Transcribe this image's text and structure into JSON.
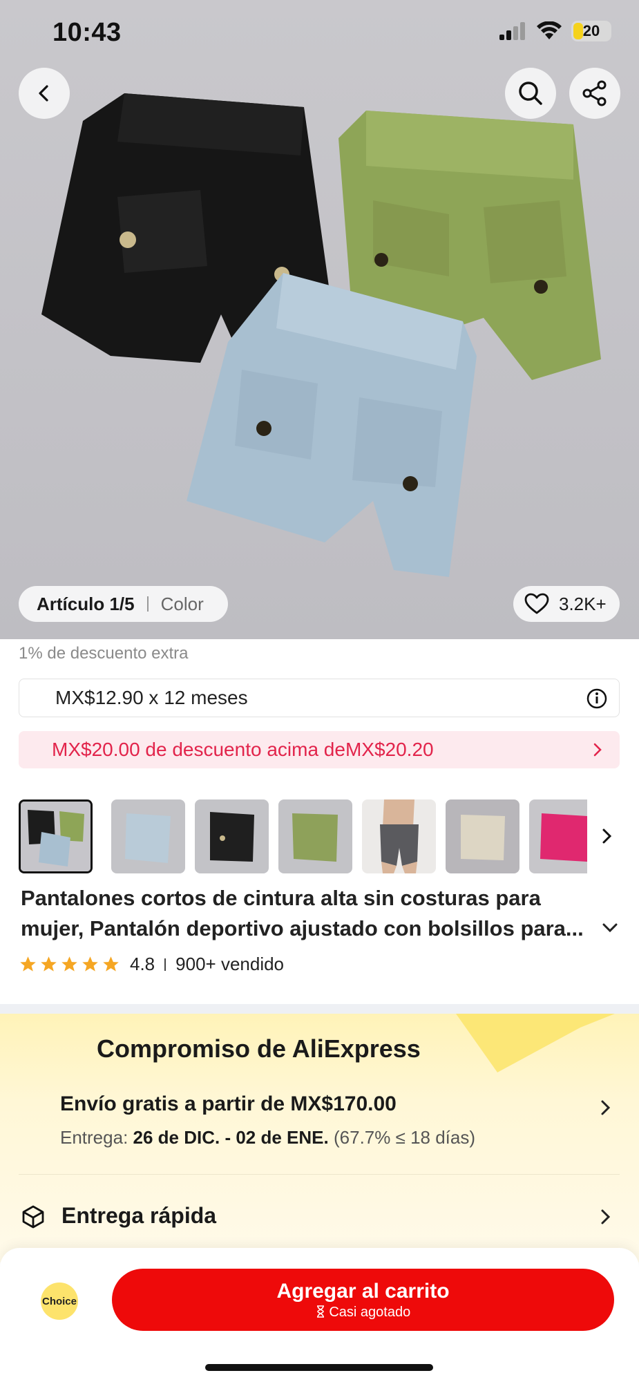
{
  "status": {
    "time": "10:43",
    "battery": "20"
  },
  "gallery": {
    "article_label": "Artículo 1/5",
    "color_label": "Color",
    "likes": "3.2K+"
  },
  "pricing": {
    "extra_discount": "1% de descuento extra",
    "installments": "MX$12.90 x 12 meses",
    "promo": "MX$20.00 de descuento acima deMX$20.20"
  },
  "thumbnails": [
    {
      "name": "thumb-black-blue-green",
      "color": "#2a2a2a"
    },
    {
      "name": "thumb-light-blue",
      "color": "#b9cbd8"
    },
    {
      "name": "thumb-black",
      "color": "#1f1f1f"
    },
    {
      "name": "thumb-green",
      "color": "#8ea15a"
    },
    {
      "name": "thumb-model",
      "color": "#5a5a5e"
    },
    {
      "name": "thumb-beige",
      "color": "#ddd6c4"
    },
    {
      "name": "thumb-pink",
      "color": "#e0286f"
    }
  ],
  "product": {
    "title_line1": "Pantalones cortos de cintura alta sin costuras para",
    "title_line2": "mujer, Pantalón deportivo ajustado con bolsillos para...",
    "rating": "4.8",
    "sold": "900+ vendido"
  },
  "commitment": {
    "title": "Compromiso de AliExpress",
    "shipping": "Envío gratis a partir de MX$170.00",
    "delivery_label": "Entrega:",
    "delivery_dates": "26 de DIC. - 02 de ENE.",
    "delivery_note": "(67.7% ≤ 18 días)",
    "fast_delivery": "Entrega rápida"
  },
  "bottom_bar": {
    "choice": "Choice",
    "cart_label": "Agregar al carrito",
    "cart_sub": "Casi agotado"
  },
  "colors": {
    "accent_red": "#ee0a0a",
    "promo_red": "#e2244b",
    "promo_bg": "#fdeaee",
    "commit_bg": "#fff3b8",
    "star": "#f5a623"
  }
}
